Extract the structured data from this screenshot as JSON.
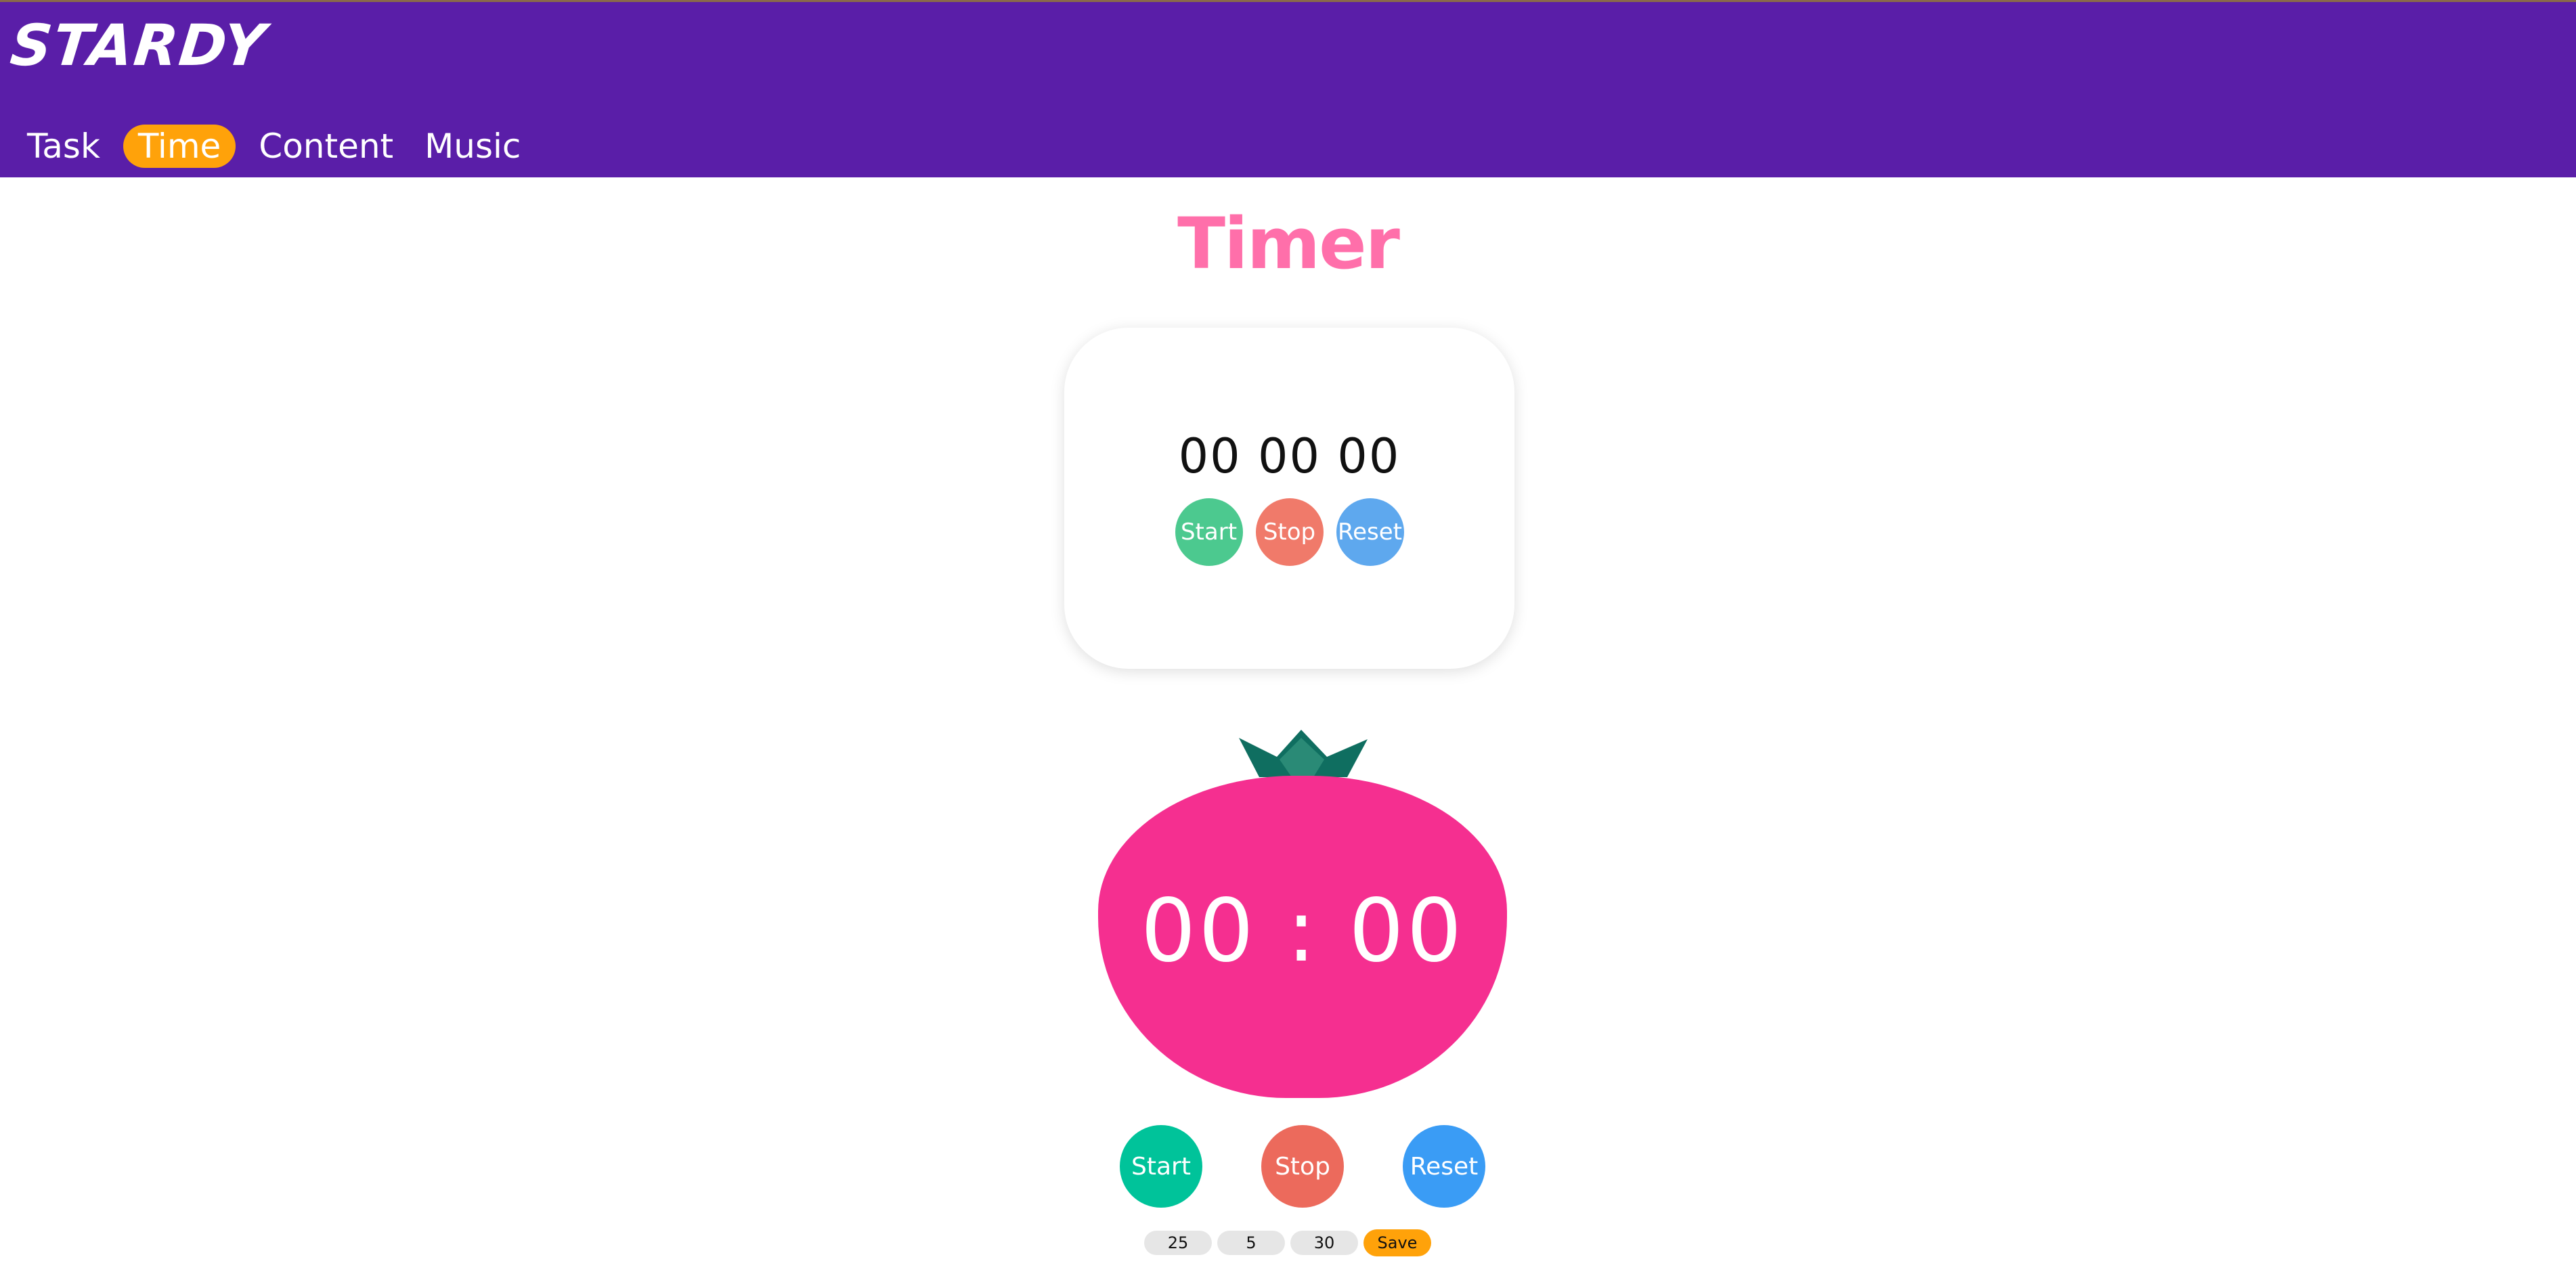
{
  "app": {
    "logo": "STARDY"
  },
  "nav": {
    "items": [
      {
        "label": "Task",
        "active": false
      },
      {
        "label": "Time",
        "active": true
      },
      {
        "label": "Content",
        "active": false
      },
      {
        "label": "Music",
        "active": false
      }
    ]
  },
  "page": {
    "title": "Timer"
  },
  "stopwatch": {
    "display": "00 00 00",
    "start_label": "Start",
    "stop_label": "Stop",
    "reset_label": "Reset"
  },
  "pomodoro": {
    "display": "00 : 00",
    "start_label": "Start",
    "stop_label": "Stop",
    "reset_label": "Reset"
  },
  "settings": {
    "work_minutes": "25",
    "short_break": "5",
    "long_break": "30",
    "save_label": "Save"
  },
  "colors": {
    "header": "#5a1ea8",
    "nav_active": "#ffa20a",
    "title": "#ff6faa",
    "tomato": "#f52f90",
    "leaves": "#1a7a6a",
    "sw_start": "#4cc98f",
    "sw_stop": "#f07a6a",
    "sw_reset": "#5ea8ee",
    "pomo_start": "#00c39a",
    "pomo_stop": "#ec6a5c",
    "pomo_reset": "#3a9cf5"
  },
  "icons": {
    "tomato_leaves": "tomato-leaves-icon"
  }
}
